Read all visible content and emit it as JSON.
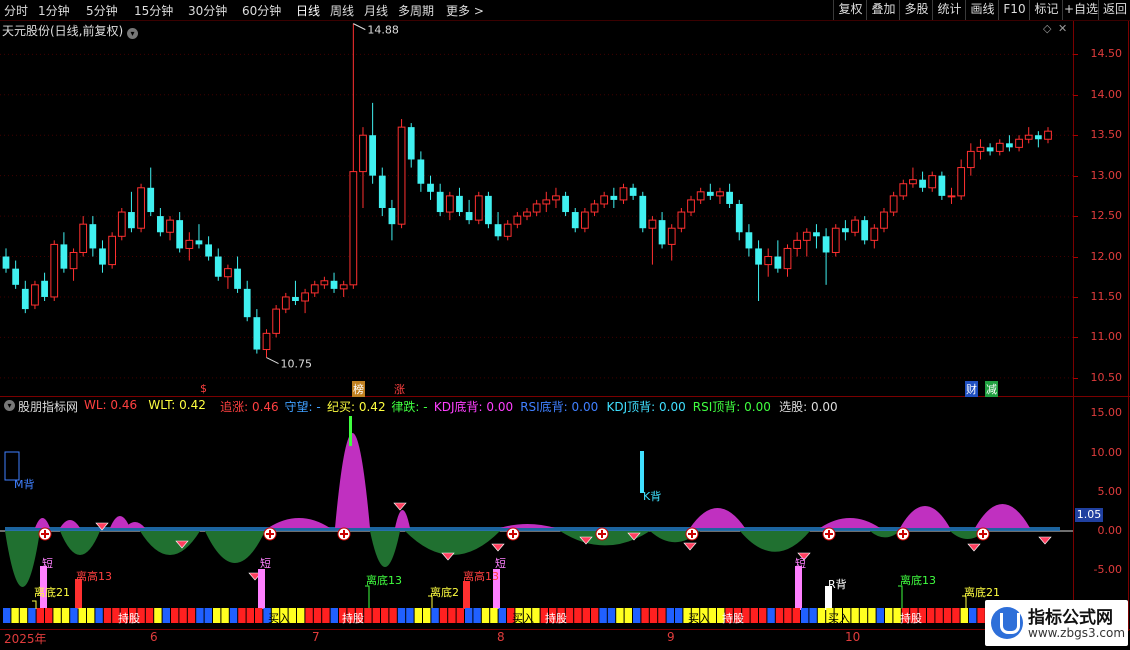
{
  "toolbar": {
    "periods": [
      "分时",
      "1分钟",
      "5分钟",
      "15分钟",
      "30分钟",
      "60分钟",
      "日线",
      "周线",
      "月线",
      "多周期",
      "更多 >"
    ],
    "actions": [
      "复权",
      "叠加",
      "多股",
      "统计",
      "画线",
      "F10",
      "标记",
      "+自选",
      "返回"
    ],
    "active_period": "日线"
  },
  "price_pane": {
    "title": "天元股份(日线,前复权)",
    "high_marker": "14.88",
    "low_marker": "10.75",
    "y_labels": [
      "14.50",
      "14.00",
      "13.50",
      "13.00",
      "12.50",
      "12.00",
      "11.50",
      "11.00",
      "10.50"
    ],
    "event_tags": [
      "$",
      "榜",
      "涨",
      "财",
      "减"
    ]
  },
  "indicator_pane": {
    "name": "股朋指标网",
    "legend": [
      {
        "label": "WL: 0.46",
        "color": "#ff4040"
      },
      {
        "label": "WLT: 0.42",
        "color": "#ffff40"
      },
      {
        "label": "追涨: 0.46",
        "color": "#ff4040"
      },
      {
        "label": "守望: -",
        "color": "#40a0ff"
      },
      {
        "label": "纪买: 0.42",
        "color": "#ffff40"
      },
      {
        "label": "律跌: -",
        "color": "#40ff40"
      },
      {
        "label": "KDJ底背: 0.00",
        "color": "#ff40ff"
      },
      {
        "label": "RSI底背: 0.00",
        "color": "#4080ff"
      },
      {
        "label": "KDJ顶背: 0.00",
        "color": "#40e0ff"
      },
      {
        "label": "RSI顶背: 0.00",
        "color": "#40ff40"
      },
      {
        "label": "选股: 0.00",
        "color": "#dddddd"
      }
    ],
    "y_labels": [
      "15.00",
      "10.00",
      "5.00",
      "0.00",
      "-5.00"
    ],
    "current_value": "1.05",
    "annotations": {
      "m_back": "M背",
      "k_back": "K背",
      "r_back": "R背",
      "short": "短",
      "lidi21": "离底21",
      "ligao13": "离高13",
      "lidi13": "离底13",
      "lidi2": "离底2",
      "chigu": "持股",
      "mairu": "买入",
      "mai": "卖",
      "ru": "入",
      "chao": "超"
    }
  },
  "x_axis": {
    "labels": [
      "2025年",
      "6",
      "7",
      "8",
      "9",
      "10"
    ]
  },
  "watermark": {
    "title": "指标公式网",
    "url": "www.zbgs3.com"
  },
  "chart_data": {
    "type": "candlestick",
    "title": "天元股份(日线,前复权)",
    "ylim": [
      10.3,
      14.9
    ],
    "ohlc": [
      [
        12.0,
        12.1,
        11.8,
        11.85
      ],
      [
        11.85,
        11.95,
        11.6,
        11.65
      ],
      [
        11.6,
        11.7,
        11.3,
        11.35
      ],
      [
        11.4,
        11.7,
        11.35,
        11.65
      ],
      [
        11.7,
        11.8,
        11.45,
        11.5
      ],
      [
        11.5,
        12.2,
        11.45,
        12.15
      ],
      [
        12.15,
        12.3,
        11.8,
        11.85
      ],
      [
        11.85,
        12.1,
        11.7,
        12.05
      ],
      [
        12.05,
        12.5,
        12.0,
        12.4
      ],
      [
        12.4,
        12.5,
        12.0,
        12.1
      ],
      [
        12.1,
        12.2,
        11.8,
        11.9
      ],
      [
        11.9,
        12.3,
        11.85,
        12.25
      ],
      [
        12.25,
        12.6,
        12.2,
        12.55
      ],
      [
        12.55,
        12.8,
        12.3,
        12.35
      ],
      [
        12.35,
        12.9,
        12.3,
        12.85
      ],
      [
        12.85,
        13.1,
        12.5,
        12.55
      ],
      [
        12.5,
        12.6,
        12.25,
        12.3
      ],
      [
        12.3,
        12.5,
        12.2,
        12.45
      ],
      [
        12.45,
        12.55,
        12.05,
        12.1
      ],
      [
        12.1,
        12.3,
        11.95,
        12.2
      ],
      [
        12.2,
        12.4,
        12.1,
        12.15
      ],
      [
        12.15,
        12.25,
        11.95,
        12.0
      ],
      [
        12.0,
        12.1,
        11.7,
        11.75
      ],
      [
        11.75,
        11.9,
        11.6,
        11.85
      ],
      [
        11.85,
        12.0,
        11.55,
        11.6
      ],
      [
        11.6,
        11.7,
        11.2,
        11.25
      ],
      [
        11.25,
        11.35,
        10.8,
        10.85
      ],
      [
        10.85,
        11.1,
        10.75,
        11.05
      ],
      [
        11.05,
        11.4,
        11.0,
        11.35
      ],
      [
        11.35,
        11.55,
        11.3,
        11.5
      ],
      [
        11.5,
        11.7,
        11.4,
        11.45
      ],
      [
        11.45,
        11.6,
        11.3,
        11.55
      ],
      [
        11.55,
        11.7,
        11.5,
        11.65
      ],
      [
        11.65,
        11.75,
        11.6,
        11.7
      ],
      [
        11.7,
        11.8,
        11.55,
        11.6
      ],
      [
        11.6,
        11.7,
        11.5,
        11.65
      ],
      [
        11.65,
        14.88,
        11.6,
        13.05
      ],
      [
        13.05,
        13.6,
        12.6,
        13.5
      ],
      [
        13.5,
        13.9,
        12.9,
        13.0
      ],
      [
        13.0,
        13.1,
        12.5,
        12.6
      ],
      [
        12.6,
        12.7,
        12.2,
        12.4
      ],
      [
        12.4,
        13.7,
        12.35,
        13.6
      ],
      [
        13.6,
        13.65,
        13.1,
        13.2
      ],
      [
        13.2,
        13.3,
        12.8,
        12.9
      ],
      [
        12.9,
        13.0,
        12.7,
        12.8
      ],
      [
        12.8,
        12.9,
        12.5,
        12.55
      ],
      [
        12.55,
        12.8,
        12.45,
        12.75
      ],
      [
        12.75,
        12.85,
        12.5,
        12.55
      ],
      [
        12.55,
        12.7,
        12.4,
        12.45
      ],
      [
        12.45,
        12.8,
        12.4,
        12.75
      ],
      [
        12.75,
        12.8,
        12.35,
        12.4
      ],
      [
        12.4,
        12.55,
        12.2,
        12.25
      ],
      [
        12.25,
        12.45,
        12.2,
        12.4
      ],
      [
        12.4,
        12.55,
        12.35,
        12.5
      ],
      [
        12.5,
        12.6,
        12.45,
        12.55
      ],
      [
        12.55,
        12.7,
        12.5,
        12.65
      ],
      [
        12.65,
        12.8,
        12.55,
        12.7
      ],
      [
        12.7,
        12.85,
        12.6,
        12.75
      ],
      [
        12.75,
        12.8,
        12.5,
        12.55
      ],
      [
        12.55,
        12.6,
        12.3,
        12.35
      ],
      [
        12.35,
        12.6,
        12.3,
        12.55
      ],
      [
        12.55,
        12.7,
        12.5,
        12.65
      ],
      [
        12.65,
        12.8,
        12.6,
        12.75
      ],
      [
        12.75,
        12.85,
        12.6,
        12.7
      ],
      [
        12.7,
        12.9,
        12.65,
        12.85
      ],
      [
        12.85,
        12.9,
        12.7,
        12.75
      ],
      [
        12.75,
        12.8,
        12.3,
        12.35
      ],
      [
        12.35,
        12.5,
        11.9,
        12.45
      ],
      [
        12.45,
        12.55,
        12.1,
        12.15
      ],
      [
        12.15,
        12.4,
        11.95,
        12.35
      ],
      [
        12.35,
        12.6,
        12.3,
        12.55
      ],
      [
        12.55,
        12.75,
        12.5,
        12.7
      ],
      [
        12.7,
        12.85,
        12.65,
        12.8
      ],
      [
        12.8,
        12.9,
        12.7,
        12.75
      ],
      [
        12.75,
        12.85,
        12.65,
        12.8
      ],
      [
        12.8,
        12.9,
        12.6,
        12.65
      ],
      [
        12.65,
        12.7,
        12.2,
        12.3
      ],
      [
        12.3,
        12.4,
        12.0,
        12.1
      ],
      [
        12.1,
        12.2,
        11.45,
        11.9
      ],
      [
        11.9,
        12.1,
        11.75,
        12.0
      ],
      [
        12.0,
        12.2,
        11.8,
        11.85
      ],
      [
        11.85,
        12.15,
        11.75,
        12.1
      ],
      [
        12.1,
        12.3,
        12.0,
        12.2
      ],
      [
        12.2,
        12.35,
        12.0,
        12.3
      ],
      [
        12.3,
        12.4,
        12.1,
        12.25
      ],
      [
        12.25,
        12.35,
        11.65,
        12.05
      ],
      [
        12.05,
        12.4,
        12.0,
        12.35
      ],
      [
        12.35,
        12.45,
        12.2,
        12.3
      ],
      [
        12.3,
        12.5,
        12.25,
        12.45
      ],
      [
        12.45,
        12.5,
        12.15,
        12.2
      ],
      [
        12.2,
        12.4,
        12.1,
        12.35
      ],
      [
        12.35,
        12.6,
        12.3,
        12.55
      ],
      [
        12.55,
        12.8,
        12.5,
        12.75
      ],
      [
        12.75,
        12.95,
        12.7,
        12.9
      ],
      [
        12.9,
        13.1,
        12.85,
        12.95
      ],
      [
        12.95,
        13.05,
        12.8,
        12.85
      ],
      [
        12.85,
        13.05,
        12.8,
        13.0
      ],
      [
        13.0,
        13.05,
        12.7,
        12.75
      ],
      [
        12.75,
        12.85,
        12.65,
        12.75
      ],
      [
        12.75,
        13.2,
        12.7,
        13.1
      ],
      [
        13.1,
        13.4,
        13.0,
        13.3
      ],
      [
        13.3,
        13.45,
        13.2,
        13.35
      ],
      [
        13.35,
        13.4,
        13.25,
        13.3
      ],
      [
        13.3,
        13.45,
        13.25,
        13.4
      ],
      [
        13.4,
        13.5,
        13.3,
        13.35
      ],
      [
        13.35,
        13.5,
        13.3,
        13.45
      ],
      [
        13.45,
        13.6,
        13.4,
        13.5
      ],
      [
        13.5,
        13.55,
        13.35,
        13.45
      ],
      [
        13.45,
        13.6,
        13.4,
        13.55
      ]
    ]
  }
}
